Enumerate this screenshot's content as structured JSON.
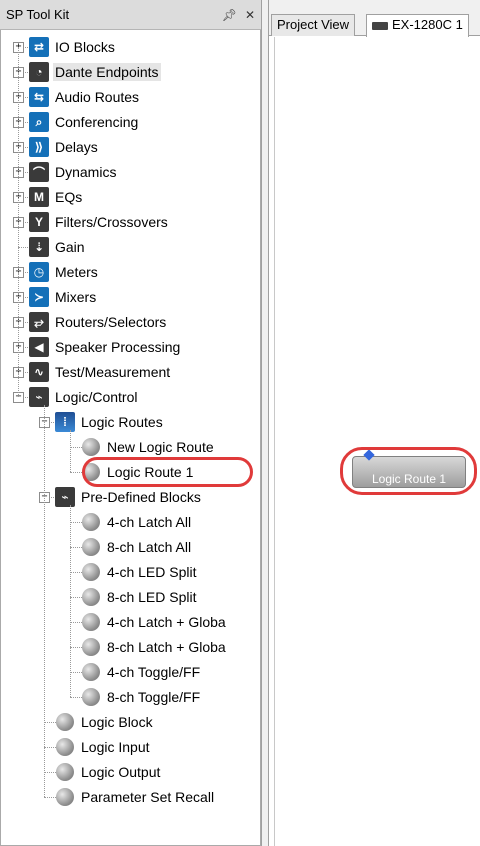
{
  "left_panel": {
    "title": "SP Tool Kit",
    "pin_icon": "pin-icon",
    "close_icon": "close-icon",
    "tree": [
      {
        "label": "IO Blocks"
      },
      {
        "label": "Dante Endpoints"
      },
      {
        "label": "Audio Routes"
      },
      {
        "label": "Conferencing"
      },
      {
        "label": "Delays"
      },
      {
        "label": "Dynamics"
      },
      {
        "label": "EQs"
      },
      {
        "label": "Filters/Crossovers"
      },
      {
        "label": "Gain"
      },
      {
        "label": "Meters"
      },
      {
        "label": "Mixers"
      },
      {
        "label": "Routers/Selectors"
      },
      {
        "label": "Speaker Processing"
      },
      {
        "label": "Test/Measurement"
      },
      {
        "label": "Logic/Control"
      },
      {
        "label": "Logic Routes"
      },
      {
        "label": "New Logic Route"
      },
      {
        "label": "Logic Route 1"
      },
      {
        "label": "Pre-Defined Blocks"
      },
      {
        "label": "4-ch Latch All"
      },
      {
        "label": "8-ch Latch All"
      },
      {
        "label": "4-ch LED Split"
      },
      {
        "label": "8-ch LED Split"
      },
      {
        "label": "4-ch Latch + Globa"
      },
      {
        "label": "8-ch Latch + Globa"
      },
      {
        "label": "4-ch Toggle/FF"
      },
      {
        "label": "8-ch Toggle/FF"
      },
      {
        "label": "Logic Block"
      },
      {
        "label": "Logic Input"
      },
      {
        "label": "Logic Output"
      },
      {
        "label": "Parameter Set Recall"
      }
    ]
  },
  "right_panel": {
    "tabs": [
      {
        "label": "Project View"
      },
      {
        "label": "EX-1280C 1"
      }
    ],
    "block_label": "Logic Route 1"
  },
  "colors": {
    "highlight_ring": "#e03a3a",
    "icon_blue": "#1470b8"
  }
}
